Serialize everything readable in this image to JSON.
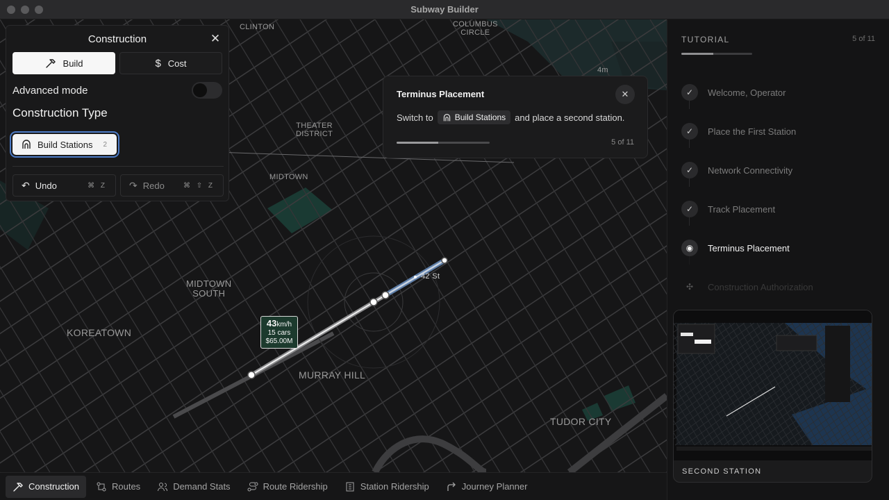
{
  "window": {
    "title": "Subway Builder"
  },
  "map": {
    "labels": {
      "clinton": "CLINTON",
      "columbus_circle": "COLUMBUS\nCIRCLE",
      "theater_district": "THEATER\nDISTRICT",
      "midtown": "MIDTOWN",
      "midtown_south": "MIDTOWN\nSOUTH",
      "koreatown": "KOREATOWN",
      "murray_hill": "MURRAY HILL",
      "tudor_city": "TUDOR CITY",
      "station_42st": "42 St",
      "distance": "4m"
    },
    "speed_label": {
      "value": "43",
      "unit": "km/h",
      "cars": "15 cars",
      "cost": "$65.00M"
    }
  },
  "construction_panel": {
    "title": "Construction",
    "tabs": {
      "build": "Build",
      "cost": "Cost"
    },
    "advanced_mode_label": "Advanced mode",
    "advanced_mode_on": false,
    "construction_type_label": "Construction Type",
    "chip": {
      "label": "Build Stations",
      "badge": "2"
    },
    "undo": {
      "label": "Undo",
      "shortcut": "⌘ Z"
    },
    "redo": {
      "label": "Redo",
      "shortcut": "⌘ ⇧ Z"
    }
  },
  "tooltip": {
    "title": "Terminus Placement",
    "text_before": "Switch to",
    "chip_label": "Build Stations",
    "text_after": "and place a second station.",
    "count": "5 of 11",
    "progress": 0.45
  },
  "tutorial": {
    "heading": "TUTORIAL",
    "count": "5 of 11",
    "progress": 0.45,
    "steps": [
      {
        "label": "Welcome, Operator",
        "state": "done"
      },
      {
        "label": "Place the First Station",
        "state": "done"
      },
      {
        "label": "Network Connectivity",
        "state": "done"
      },
      {
        "label": "Track Placement",
        "state": "done"
      },
      {
        "label": "Terminus Placement",
        "state": "current"
      },
      {
        "label": "Construction Authorization",
        "state": "upcoming"
      }
    ],
    "preview_caption": "SECOND STATION"
  },
  "tabbar": {
    "tabs": [
      {
        "label": "Construction",
        "icon": "hammer-icon"
      },
      {
        "label": "Routes",
        "icon": "routes-icon"
      },
      {
        "label": "Demand Stats",
        "icon": "users-icon"
      },
      {
        "label": "Route Ridership",
        "icon": "route-icon"
      },
      {
        "label": "Station Ridership",
        "icon": "building-icon"
      },
      {
        "label": "Journey Planner",
        "icon": "arrow-turn-icon"
      }
    ]
  }
}
